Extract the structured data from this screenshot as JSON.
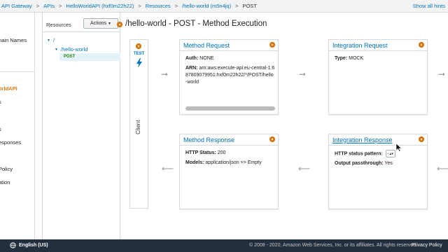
{
  "breadcrumb": {
    "items": [
      "API Gateway",
      "APIs",
      "HelloWorldAPI (hxf0m22h22)",
      "Resources",
      "/hello-world (m5n4jq)"
    ],
    "current": "POST",
    "separator": ">"
  },
  "hints_link": "Show all hints",
  "left_nav": {
    "items": [
      "main Names",
      "orldAPI",
      "s",
      "s",
      "esponses",
      "Policy",
      "ation"
    ],
    "active_index": 1
  },
  "resources_panel": {
    "title": "Resources",
    "actions_label": "Actions",
    "tree": [
      "/",
      "/hello-world",
      "POST"
    ]
  },
  "page_title": "/hello-world - POST - Method Execution",
  "client": {
    "test_label": "TEST",
    "label": "Client"
  },
  "method_request": {
    "title": "Method Request",
    "auth_key": "Auth:",
    "auth_value": "NONE",
    "arn_key": "ARN:",
    "arn_value": "arn:aws:execute-api:eu-central-1:687809079951:hxf0m22h22/*/POST/hello-world"
  },
  "integration_request": {
    "title": "Integration Request",
    "type_key": "Type:",
    "type_value": "MOCK"
  },
  "method_response": {
    "title": "Method Response",
    "status_key": "HTTP Status:",
    "status_value": "200",
    "models_key": "Models:",
    "models_value": "application/json => Empty"
  },
  "integration_response": {
    "title": "Integration Response",
    "pattern_key": "HTTP status pattern:",
    "pattern_value": "-",
    "passthrough_key": "Output passthrough:",
    "passthrough_value": "Yes"
  },
  "footer": {
    "language": "English (US)",
    "copyright": "© 2008 - 2020, Amazon Web Services, Inc. or its affiliates. All rights reserved.",
    "privacy": "Privacy Policy"
  },
  "colors": {
    "link": "#0073bb",
    "accent": "#e07b10",
    "footer_bg": "#232f3e",
    "post_green": "#1d8102"
  },
  "icons": [
    "settings-dot-icon",
    "lightning-bolt-icon",
    "arrow-right-icon",
    "arrow-left-icon",
    "globe-icon",
    "mouse-cursor-icon"
  ]
}
